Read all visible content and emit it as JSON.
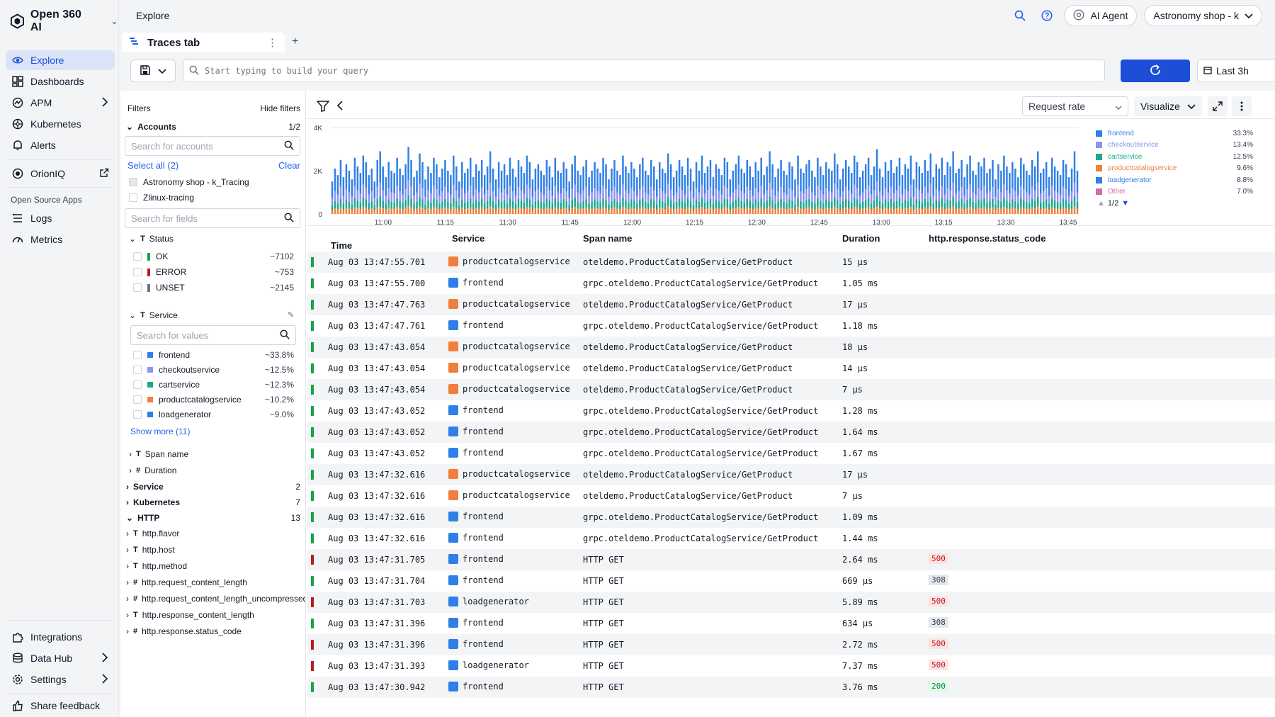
{
  "app": {
    "name": "Open 360 AI"
  },
  "nav": {
    "items": [
      {
        "label": "Explore",
        "icon": "eye-icon"
      },
      {
        "label": "Dashboards",
        "icon": "dashboard-icon"
      },
      {
        "label": "APM",
        "icon": "apm-icon"
      },
      {
        "label": "Kubernetes",
        "icon": "kubernetes-icon"
      },
      {
        "label": "Alerts",
        "icon": "bell-icon"
      }
    ],
    "orion": {
      "label": "OrionIQ"
    },
    "section_label": "Open Source Apps",
    "oss": [
      {
        "label": "Logs"
      },
      {
        "label": "Metrics"
      }
    ],
    "bottom": [
      {
        "label": "Integrations"
      },
      {
        "label": "Data Hub"
      },
      {
        "label": "Settings"
      },
      {
        "label": "Share feedback"
      }
    ]
  },
  "header": {
    "breadcrumb": "Explore",
    "ai_agent": "AI Agent",
    "account": "Astronomy shop - k"
  },
  "tabs": {
    "active": "Traces tab"
  },
  "query": {
    "placeholder": "Start typing to build your query",
    "time_range": "Last 3h"
  },
  "filters": {
    "title": "Filters",
    "hide": "Hide filters",
    "accounts": {
      "label": "Accounts",
      "count": "1/2",
      "search_placeholder": "Search for accounts",
      "select_all": "Select all (2)",
      "clear": "Clear",
      "items": [
        "Astronomy shop - k_Tracing",
        "Zlinux-tracing"
      ]
    },
    "fields_search_placeholder": "Search for fields",
    "status": {
      "label": "Status",
      "items": [
        {
          "label": "OK",
          "value": "~7102",
          "color": "#16a34a"
        },
        {
          "label": "ERROR",
          "value": "~753",
          "color": "#b91c1c"
        },
        {
          "label": "UNSET",
          "value": "~2145",
          "color": "#6b7280"
        }
      ]
    },
    "service": {
      "label": "Service",
      "search_placeholder": "Search for values",
      "items": [
        {
          "label": "frontend",
          "value": "~33.8%",
          "color": "#2f7fe6"
        },
        {
          "label": "checkoutservice",
          "value": "~12.5%",
          "color": "#8b94f0"
        },
        {
          "label": "cartservice",
          "value": "~12.3%",
          "color": "#19a88a"
        },
        {
          "label": "productcatalogservice",
          "value": "~10.2%",
          "color": "#f07f3c"
        },
        {
          "label": "loadgenerator",
          "value": "~9.0%",
          "color": "#2f7fe6"
        }
      ],
      "show_more": "Show more (11)"
    },
    "more_fields": [
      "Span name",
      "Duration"
    ],
    "groups": [
      {
        "label": "Service",
        "count": "2"
      },
      {
        "label": "Kubernetes",
        "count": "7"
      },
      {
        "label": "HTTP",
        "count": "13"
      }
    ],
    "http_fields": [
      {
        "type": "T",
        "label": "http.flavor"
      },
      {
        "type": "T",
        "label": "http.host"
      },
      {
        "type": "T",
        "label": "http.method"
      },
      {
        "type": "#",
        "label": "http.request_content_length"
      },
      {
        "type": "#",
        "label": "http.request_content_length_uncompressed"
      },
      {
        "type": "T",
        "label": "http.response_content_length"
      },
      {
        "type": "#",
        "label": "http.response.status_code"
      }
    ]
  },
  "chart_controls": {
    "metric": "Request rate",
    "visualize": "Visualize"
  },
  "chart_data": {
    "type": "bar",
    "stacked": true,
    "y_ticks": [
      "4K",
      "2K",
      "0"
    ],
    "ylim": [
      0,
      4000
    ],
    "x_ticks": [
      "11:00",
      "11:15",
      "11:30",
      "11:45",
      "12:00",
      "12:15",
      "12:30",
      "12:45",
      "13:00",
      "13:15",
      "13:30",
      "13:45"
    ],
    "grid": true,
    "legend_position": "right",
    "legend": [
      {
        "name": "frontend",
        "pct": "33.3%",
        "color": "#2f7fe6"
      },
      {
        "name": "checkoutservice",
        "pct": "13.4%",
        "color": "#8b94f0"
      },
      {
        "name": "cartservice",
        "pct": "12.5%",
        "color": "#19a88a"
      },
      {
        "name": "productcatalogservice",
        "pct": "9.6%",
        "color": "#f07f3c"
      },
      {
        "name": "loadgenerator",
        "pct": "8.8%",
        "color": "#2f7fe6"
      },
      {
        "name": "Other",
        "pct": "7.0%",
        "color": "#d46aa8"
      }
    ],
    "legend_page": "1/2",
    "bar_colors": [
      "#f07f3c",
      "#19a88a",
      "#8b94f0",
      "#2f7fe6"
    ],
    "totals": [
      1500,
      2100,
      1800,
      2500,
      1700,
      2300,
      2000,
      1600,
      2600,
      2200,
      1900,
      2700,
      2400,
      1800,
      2100,
      1500,
      2500,
      2900,
      2200,
      1700,
      2400,
      2000,
      1900,
      2600,
      2100,
      1800,
      2300,
      3100,
      2500,
      1700,
      2000,
      2800,
      2400,
      1600,
      2200,
      1900,
      2600,
      2300,
      1700,
      2100,
      2500,
      2000,
      1800,
      2700,
      2200,
      1500,
      2400,
      1900,
      2100,
      2600,
      1700,
      2300,
      2000,
      2500,
      1800,
      2200,
      2900,
      2100,
      1600,
      2400,
      2000,
      2300,
      1800,
      2600,
      2100,
      1700,
      2500,
      2200,
      1900,
      2700,
      2400,
      1600,
      2100,
      2300,
      2000,
      1800,
      2500,
      2200,
      1700,
      2600,
      2000,
      1900,
      2400,
      2100,
      1500,
      2300,
      2700,
      2000,
      1800,
      2200,
      2500,
      1700,
      2000,
      2400,
      2100,
      1900,
      2600,
      2300,
      1600,
      2100,
      2500,
      2000,
      1800,
      2700,
      2200,
      1900,
      2400,
      2100,
      1700,
      2300,
      2600,
      2000,
      1800,
      2500,
      2200,
      1600,
      2400,
      2100,
      1900,
      2800,
      2300,
      1700,
      2000,
      2500,
      2200,
      1800,
      2600,
      2100,
      1500,
      2400,
      2000,
      2700,
      1900,
      2200,
      2500,
      1700,
      2300,
      2100,
      1800,
      2600,
      2400,
      1600,
      2000,
      2300,
      2700,
      2100,
      1900,
      2500,
      2200,
      1700,
      2400,
      2000,
      2600,
      1800,
      2200,
      2900,
      2300,
      1700,
      2100,
      2500,
      2000,
      1800,
      2400,
      2200,
      1600,
      2700,
      2100,
      1900,
      2300,
      2500,
      2000,
      1700,
      2600,
      2200,
      1800,
      2400,
      2100,
      2000,
      2800,
      2300,
      1600,
      2100,
      2500,
      2200,
      1900,
      2700,
      2400,
      1700,
      2000,
      2300,
      2600,
      1800,
      2200,
      3000,
      2100,
      1700,
      2400,
      2000,
      2500,
      1900,
      2200,
      2600,
      1800,
      2300,
      2100,
      2700,
      1600,
      2400,
      2200,
      1900,
      2500,
      2000,
      2800,
      1700,
      2300,
      2100,
      2600,
      1800,
      2400,
      2200,
      2900,
      1900,
      2100,
      2500,
      1700,
      2300,
      2700,
      2000,
      1800,
      2400,
      2200,
      2600,
      1900,
      2100,
      2500,
      1600,
      2300,
      2000,
      2700,
      2200,
      1900,
      2400,
      2100,
      1700,
      2600,
      2300,
      2000,
      1800,
      2500,
      2200,
      2900,
      1900,
      2100,
      2400,
      1700,
      2600,
      2200,
      2000,
      1800,
      2500,
      2300,
      1700,
      2100,
      2900,
      2000
    ]
  },
  "table": {
    "columns": {
      "time": "Time",
      "service": "Service",
      "span": "Span name",
      "duration": "Duration",
      "status_code": "http.response.status_code"
    },
    "rows": [
      {
        "time": "Aug 03 13:47:55.701",
        "service": "productcatalogservice",
        "svc_color": "#f07f3c",
        "span": "oteldemo.ProductCatalogService/GetProduct",
        "duration": "15 µs",
        "code": "",
        "status": "#16a34a"
      },
      {
        "time": "Aug 03 13:47:55.700",
        "service": "frontend",
        "svc_color": "#2f7fe6",
        "span": "grpc.oteldemo.ProductCatalogService/GetProduct",
        "duration": "1.05 ms",
        "code": "",
        "status": "#16a34a"
      },
      {
        "time": "Aug 03 13:47:47.763",
        "service": "productcatalogservice",
        "svc_color": "#f07f3c",
        "span": "oteldemo.ProductCatalogService/GetProduct",
        "duration": "17 µs",
        "code": "",
        "status": "#16a34a"
      },
      {
        "time": "Aug 03 13:47:47.761",
        "service": "frontend",
        "svc_color": "#2f7fe6",
        "span": "grpc.oteldemo.ProductCatalogService/GetProduct",
        "duration": "1.18 ms",
        "code": "",
        "status": "#16a34a"
      },
      {
        "time": "Aug 03 13:47:43.054",
        "service": "productcatalogservice",
        "svc_color": "#f07f3c",
        "span": "oteldemo.ProductCatalogService/GetProduct",
        "duration": "18 µs",
        "code": "",
        "status": "#16a34a"
      },
      {
        "time": "Aug 03 13:47:43.054",
        "service": "productcatalogservice",
        "svc_color": "#f07f3c",
        "span": "oteldemo.ProductCatalogService/GetProduct",
        "duration": "14 µs",
        "code": "",
        "status": "#16a34a"
      },
      {
        "time": "Aug 03 13:47:43.054",
        "service": "productcatalogservice",
        "svc_color": "#f07f3c",
        "span": "oteldemo.ProductCatalogService/GetProduct",
        "duration": "7 µs",
        "code": "",
        "status": "#16a34a"
      },
      {
        "time": "Aug 03 13:47:43.052",
        "service": "frontend",
        "svc_color": "#2f7fe6",
        "span": "grpc.oteldemo.ProductCatalogService/GetProduct",
        "duration": "1.28 ms",
        "code": "",
        "status": "#16a34a"
      },
      {
        "time": "Aug 03 13:47:43.052",
        "service": "frontend",
        "svc_color": "#2f7fe6",
        "span": "grpc.oteldemo.ProductCatalogService/GetProduct",
        "duration": "1.64 ms",
        "code": "",
        "status": "#16a34a"
      },
      {
        "time": "Aug 03 13:47:43.052",
        "service": "frontend",
        "svc_color": "#2f7fe6",
        "span": "grpc.oteldemo.ProductCatalogService/GetProduct",
        "duration": "1.67 ms",
        "code": "",
        "status": "#16a34a"
      },
      {
        "time": "Aug 03 13:47:32.616",
        "service": "productcatalogservice",
        "svc_color": "#f07f3c",
        "span": "oteldemo.ProductCatalogService/GetProduct",
        "duration": "17 µs",
        "code": "",
        "status": "#16a34a"
      },
      {
        "time": "Aug 03 13:47:32.616",
        "service": "productcatalogservice",
        "svc_color": "#f07f3c",
        "span": "oteldemo.ProductCatalogService/GetProduct",
        "duration": "7 µs",
        "code": "",
        "status": "#16a34a"
      },
      {
        "time": "Aug 03 13:47:32.616",
        "service": "frontend",
        "svc_color": "#2f7fe6",
        "span": "grpc.oteldemo.ProductCatalogService/GetProduct",
        "duration": "1.09 ms",
        "code": "",
        "status": "#16a34a"
      },
      {
        "time": "Aug 03 13:47:32.616",
        "service": "frontend",
        "svc_color": "#2f7fe6",
        "span": "grpc.oteldemo.ProductCatalogService/GetProduct",
        "duration": "1.44 ms",
        "code": "",
        "status": "#16a34a"
      },
      {
        "time": "Aug 03 13:47:31.705",
        "service": "frontend",
        "svc_color": "#2f7fe6",
        "span": "HTTP GET",
        "duration": "2.64 ms",
        "code": "500",
        "status": "#b91c1c"
      },
      {
        "time": "Aug 03 13:47:31.704",
        "service": "frontend",
        "svc_color": "#2f7fe6",
        "span": "HTTP GET",
        "duration": "669 µs",
        "code": "308",
        "status": "#16a34a"
      },
      {
        "time": "Aug 03 13:47:31.703",
        "service": "loadgenerator",
        "svc_color": "#2f7fe6",
        "span": "HTTP GET",
        "duration": "5.89 ms",
        "code": "500",
        "status": "#b91c1c"
      },
      {
        "time": "Aug 03 13:47:31.396",
        "service": "frontend",
        "svc_color": "#2f7fe6",
        "span": "HTTP GET",
        "duration": "634 µs",
        "code": "308",
        "status": "#16a34a"
      },
      {
        "time": "Aug 03 13:47:31.396",
        "service": "frontend",
        "svc_color": "#2f7fe6",
        "span": "HTTP GET",
        "duration": "2.72 ms",
        "code": "500",
        "status": "#b91c1c"
      },
      {
        "time": "Aug 03 13:47:31.393",
        "service": "loadgenerator",
        "svc_color": "#2f7fe6",
        "span": "HTTP GET",
        "duration": "7.37 ms",
        "code": "500",
        "status": "#b91c1c"
      },
      {
        "time": "Aug 03 13:47:30.942",
        "service": "frontend",
        "svc_color": "#2f7fe6",
        "span": "HTTP GET",
        "duration": "3.76 ms",
        "code": "200",
        "status": "#16a34a"
      }
    ]
  }
}
